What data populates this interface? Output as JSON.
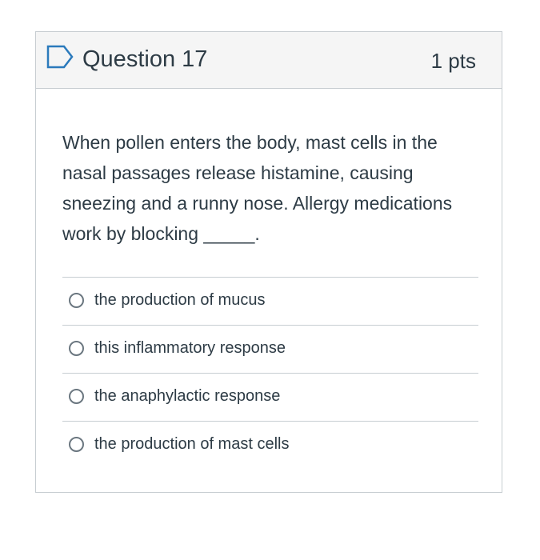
{
  "question": {
    "title": "Question 17",
    "points": "1 pts",
    "text": "When pollen enters the body, mast cells in the nasal passages release histamine, causing sneezing and a runny nose. Allergy medications work by blocking _____.",
    "flag_icon": "flag-icon",
    "answers": [
      {
        "label": "the production of mucus",
        "selected": false
      },
      {
        "label": "this inflammatory response",
        "selected": false
      },
      {
        "label": "the anaphylactic response",
        "selected": false
      },
      {
        "label": "the production of mast cells",
        "selected": false
      }
    ]
  },
  "colors": {
    "header_bg": "#f5f5f5",
    "border": "#c7cdd1",
    "text": "#2d3b45",
    "flag": "#2b7abc"
  }
}
